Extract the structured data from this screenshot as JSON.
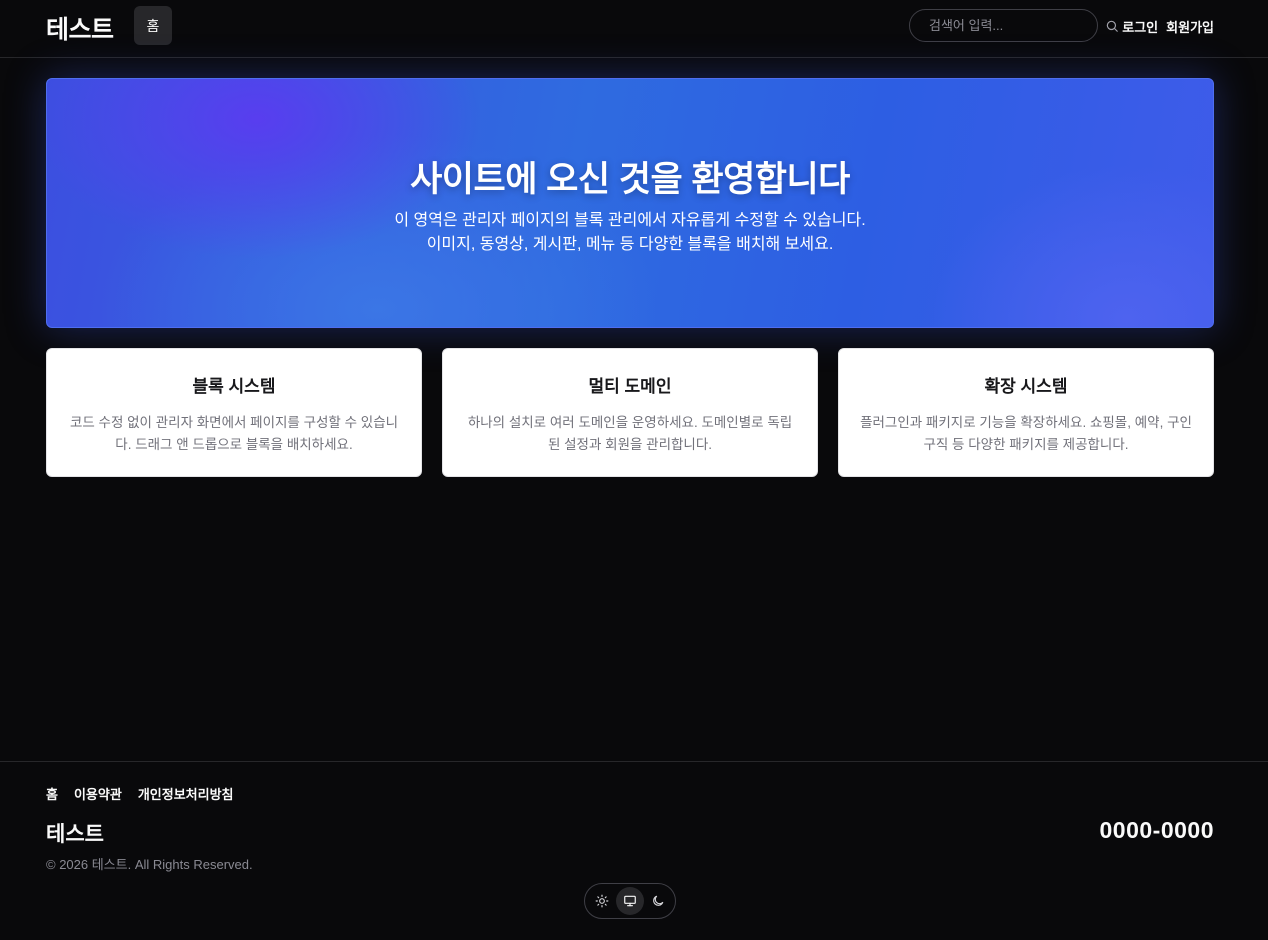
{
  "header": {
    "logo": "테스트",
    "nav": [
      {
        "label": "홈",
        "active": true
      }
    ],
    "search_placeholder": "검색어 입력...",
    "login": "로그인",
    "signup": "회원가입"
  },
  "hero": {
    "title": "사이트에 오신 것을 환영합니다",
    "line1": "이 영역은 관리자 페이지의 블록 관리에서 자유롭게 수정할 수 있습니다.",
    "line2": "이미지, 동영상, 게시판, 메뉴 등 다양한 블록을 배치해 보세요."
  },
  "features": [
    {
      "title": "블록 시스템",
      "description": "코드 수정 없이 관리자 화면에서 페이지를 구성할 수 있습니다. 드래그 앤 드롭으로 블록을 배치하세요."
    },
    {
      "title": "멀티 도메인",
      "description": "하나의 설치로 여러 도메인을 운영하세요. 도메인별로 독립된 설정과 회원을 관리합니다."
    },
    {
      "title": "확장 시스템",
      "description": "플러그인과 패키지로 기능을 확장하세요. 쇼핑몰, 예약, 구인구직 등 다양한 패키지를 제공합니다."
    }
  ],
  "footer": {
    "links": [
      "홈",
      "이용약관",
      "개인정보처리방침"
    ],
    "brand": "테스트",
    "phone": "0000-0000",
    "copyright": "© 2026 테스트. All Rights Reserved.",
    "theme_modes": [
      "sun-icon",
      "monitor-icon",
      "moon-icon"
    ],
    "theme_active": "system"
  },
  "colors": {
    "background": "#09090b",
    "hero_accent": "#3b5fe6",
    "card_background": "#ffffff"
  }
}
